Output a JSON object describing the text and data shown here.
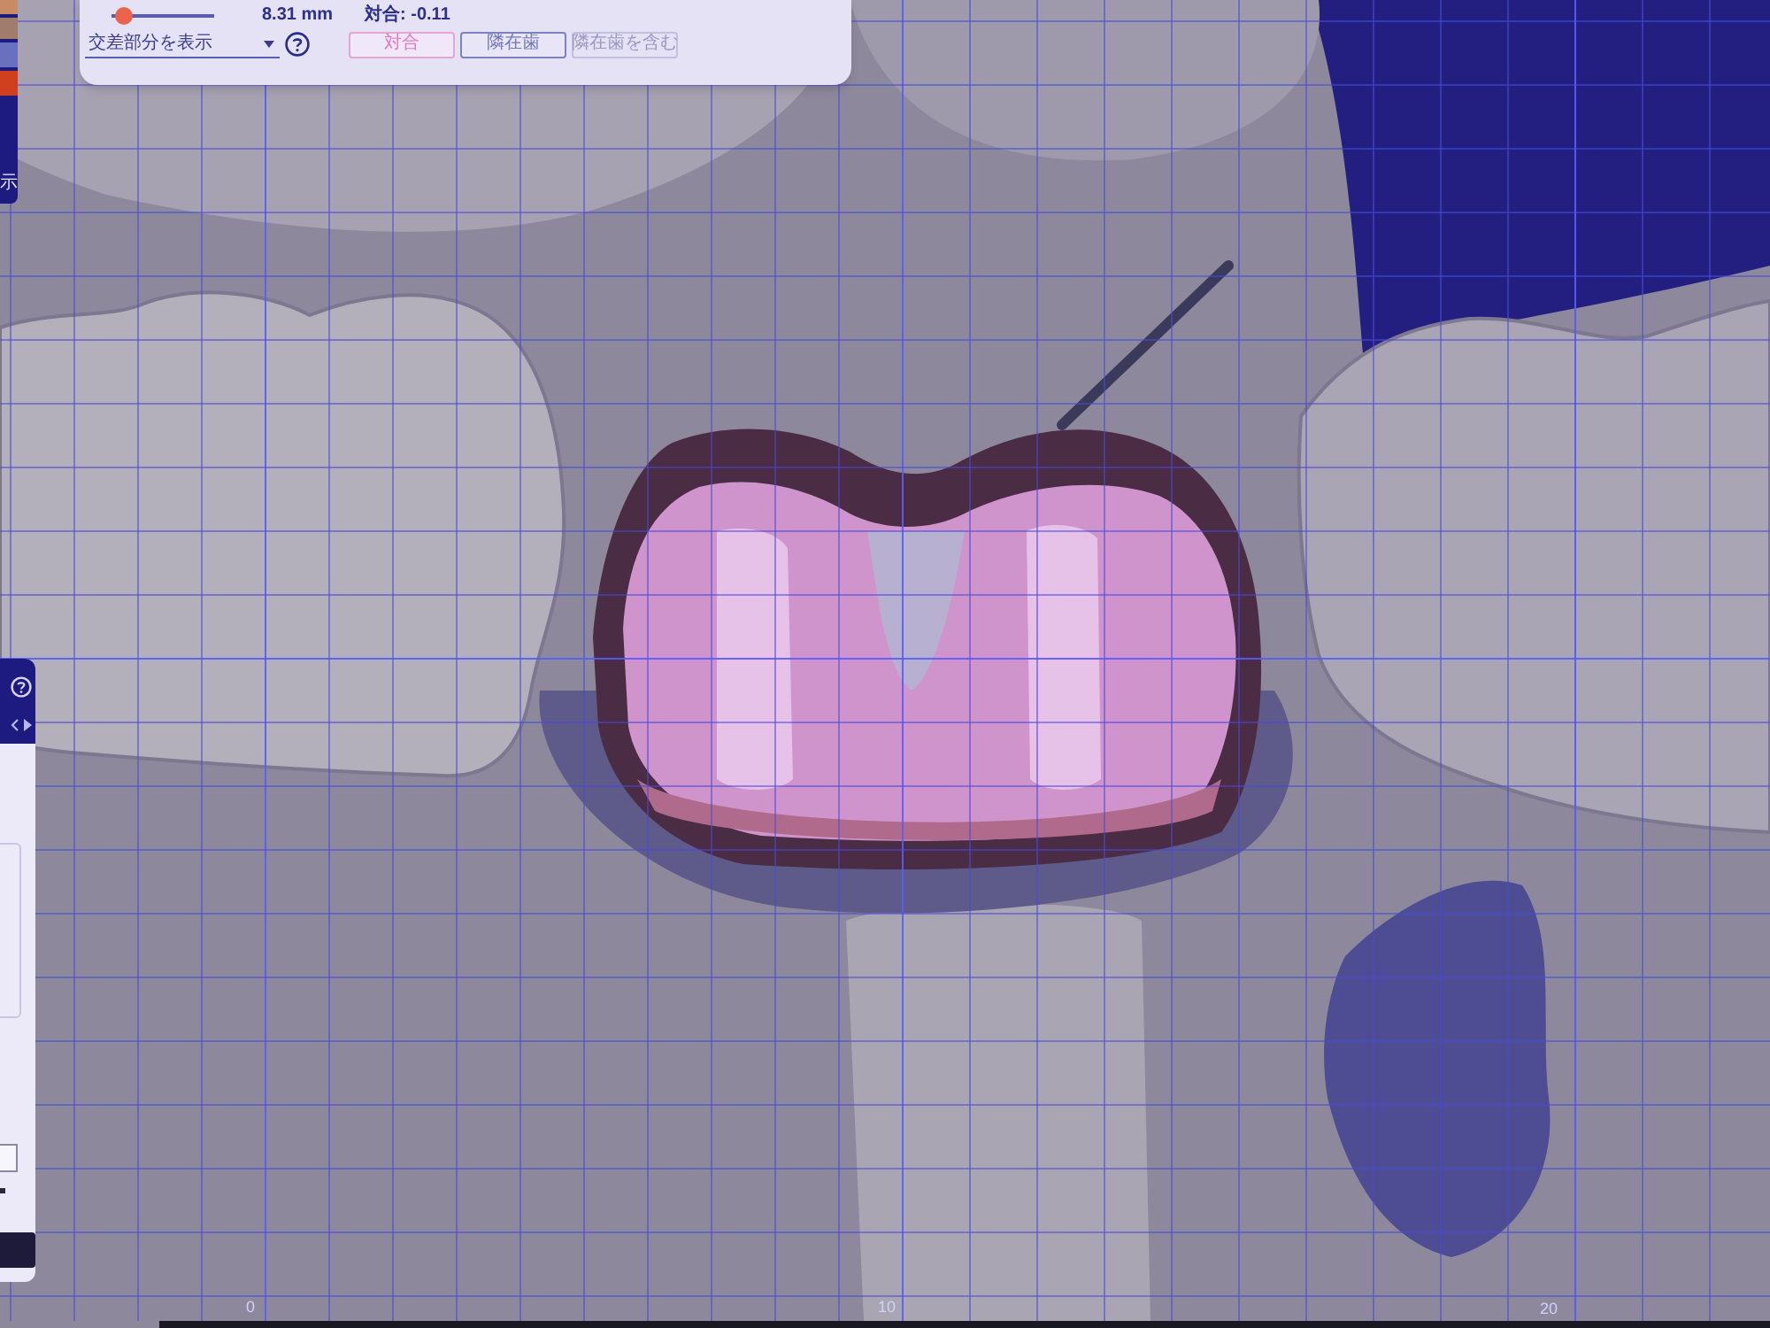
{
  "left_toolbar": {
    "swatches": [
      {
        "color": "#c98a66"
      },
      {
        "color": "#a07c6c"
      },
      {
        "color": "#6a70c0"
      },
      {
        "color": "#d0401e"
      }
    ],
    "label": "示"
  },
  "top_panel": {
    "slider": {
      "level": 0.05
    },
    "distance_reading": "8.31 mm",
    "occlusion_reading": "対合: -0.11",
    "display_dropdown": {
      "value": "交差部分を表示"
    },
    "buttons": [
      {
        "label": "対合",
        "selected": true,
        "disabled": false
      },
      {
        "label": "隣在歯",
        "selected": false,
        "disabled": false
      },
      {
        "label": "隣在歯を含む",
        "selected": false,
        "disabled": true
      }
    ]
  },
  "viewport": {
    "axis_labels": [
      "0",
      "10",
      "20"
    ]
  }
}
